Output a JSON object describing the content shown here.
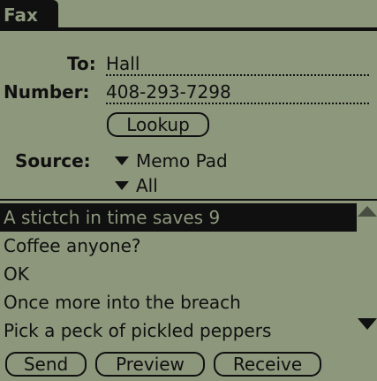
{
  "app": {
    "title": "Fax"
  },
  "form": {
    "to_label": "To:",
    "to_value": "Hall",
    "number_label": "Number:",
    "number_value": "408-293-7298",
    "lookup_label": "Lookup",
    "source_label": "Source:",
    "source_app": "Memo Pad",
    "source_category": "All"
  },
  "list": {
    "items": [
      "A stictch in time saves 9",
      "Coffee anyone?",
      "OK",
      "Once more into the breach",
      "Pick a peck of pickled peppers"
    ],
    "selected_index": 0
  },
  "buttons": {
    "send": "Send",
    "preview": "Preview",
    "receive": "Receive"
  },
  "icons": {
    "dropdown": "triangle-down-icon",
    "scroll_up": "scroll-up-arrow-icon",
    "scroll_down": "scroll-down-arrow-icon"
  },
  "colors": {
    "background": "#8c977c",
    "foreground": "#101010"
  }
}
